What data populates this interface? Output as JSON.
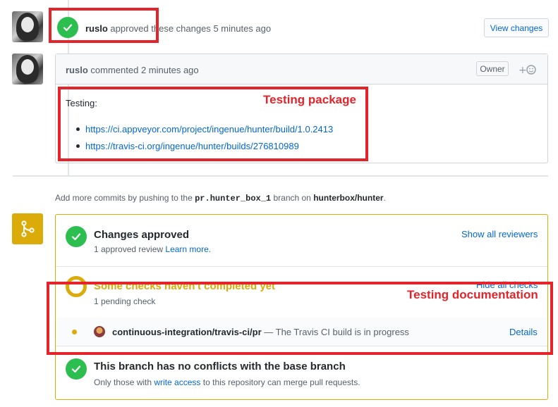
{
  "review": {
    "author": "ruslo",
    "action": "approved these changes",
    "time": "5 minutes ago",
    "view_changes": "View changes"
  },
  "comment": {
    "author": "ruslo",
    "action": "commented",
    "time": "2 minutes ago",
    "owner_badge": "Owner",
    "body_title": "Testing:",
    "links": [
      "https://ci.appveyor.com/project/ingenue/hunter/build/1.0.2413",
      "https://travis-ci.org/ingenue/hunter/builds/276810989"
    ]
  },
  "annotations": {
    "testing_package": "Testing package",
    "testing_documentation": "Testing documentation"
  },
  "push_hint": {
    "prefix": "Add more commits by pushing to the",
    "branch": "pr.hunter_box_1",
    "middle": "branch on",
    "repo": "hunterbox/hunter",
    "suffix": "."
  },
  "merge": {
    "approved_title": "Changes approved",
    "approved_sub_prefix": "1 approved review",
    "learn_more": "Learn more.",
    "show_reviewers": "Show all reviewers",
    "checks_title": "Some checks haven't completed yet",
    "checks_sub": "1 pending check",
    "hide_checks": "Hide all checks",
    "check_name": "continuous-integration/travis-ci/pr",
    "check_desc": "— The Travis CI build is in progress",
    "details": "Details",
    "conflicts_title": "This branch has no conflicts with the base branch",
    "conflicts_sub_prefix": "Only those with",
    "write_access": "write access",
    "conflicts_sub_suffix": "to this repository can merge pull requests."
  },
  "colors": {
    "success": "#2cbe4e",
    "pending": "#dbab09",
    "link": "#0366d6",
    "annotation": "#e3242b"
  }
}
